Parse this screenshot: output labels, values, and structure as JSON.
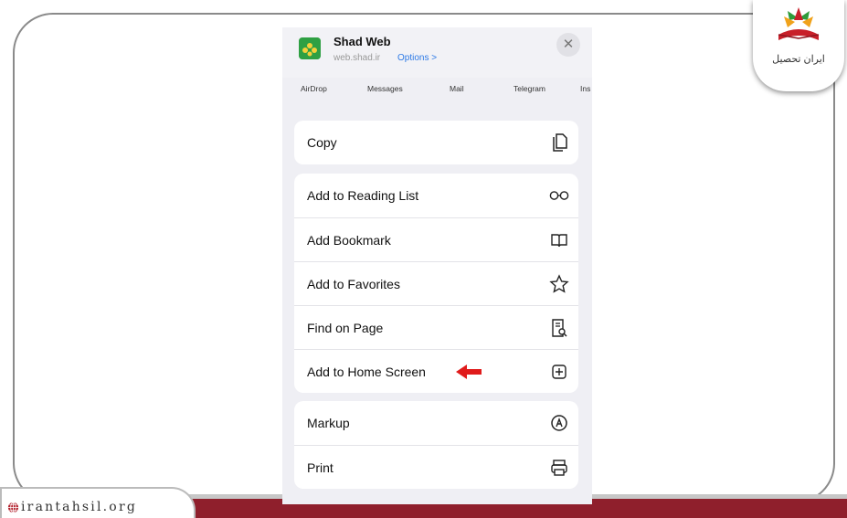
{
  "share_sheet": {
    "app_title": "Shad Web",
    "app_subtitle": "web.shad.ir",
    "options_label": "Options >",
    "close_label": "✕",
    "targets": [
      "AirDrop",
      "Messages",
      "Mail",
      "Telegram",
      "Ins"
    ],
    "groups": [
      [
        {
          "label": "Copy",
          "icon": "copy-icon"
        }
      ],
      [
        {
          "label": "Add to Reading List",
          "icon": "glasses-icon"
        },
        {
          "label": "Add Bookmark",
          "icon": "book-icon"
        },
        {
          "label": "Add to Favorites",
          "icon": "star-icon"
        },
        {
          "label": "Find on Page",
          "icon": "find-document-icon"
        },
        {
          "label": "Add to Home Screen",
          "icon": "plus-square-icon"
        }
      ],
      [
        {
          "label": "Markup",
          "icon": "markup-icon"
        },
        {
          "label": "Print",
          "icon": "printer-icon"
        }
      ]
    ]
  },
  "watermark": {
    "site": "irantahsil.org",
    "logo_text": "ایران تحصیل"
  },
  "colors": {
    "bottom_bar": "#8f1f2c",
    "arrow": "#e01b1b",
    "link_blue": "#2e7ae6",
    "app_icon_green": "#2fa043"
  }
}
